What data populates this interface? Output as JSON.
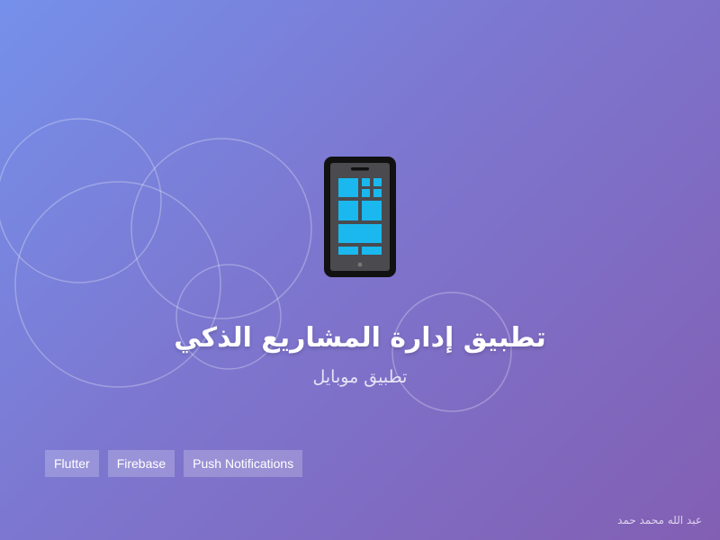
{
  "title": "تطبيق إدارة المشاريع الذكي",
  "subtitle": "تطبيق موبايل",
  "tags": [
    "Flutter",
    "Firebase",
    "Push Notifications"
  ],
  "author": "عبد الله محمد حمد",
  "icons": {
    "hero": "smartphone-icon"
  },
  "colors": {
    "gradient_start": "#7590ea",
    "gradient_end": "#825fb3",
    "phone_body": "#111111",
    "phone_screen": "#4a4a4f",
    "screen_tiles": "#1ab8ee"
  }
}
